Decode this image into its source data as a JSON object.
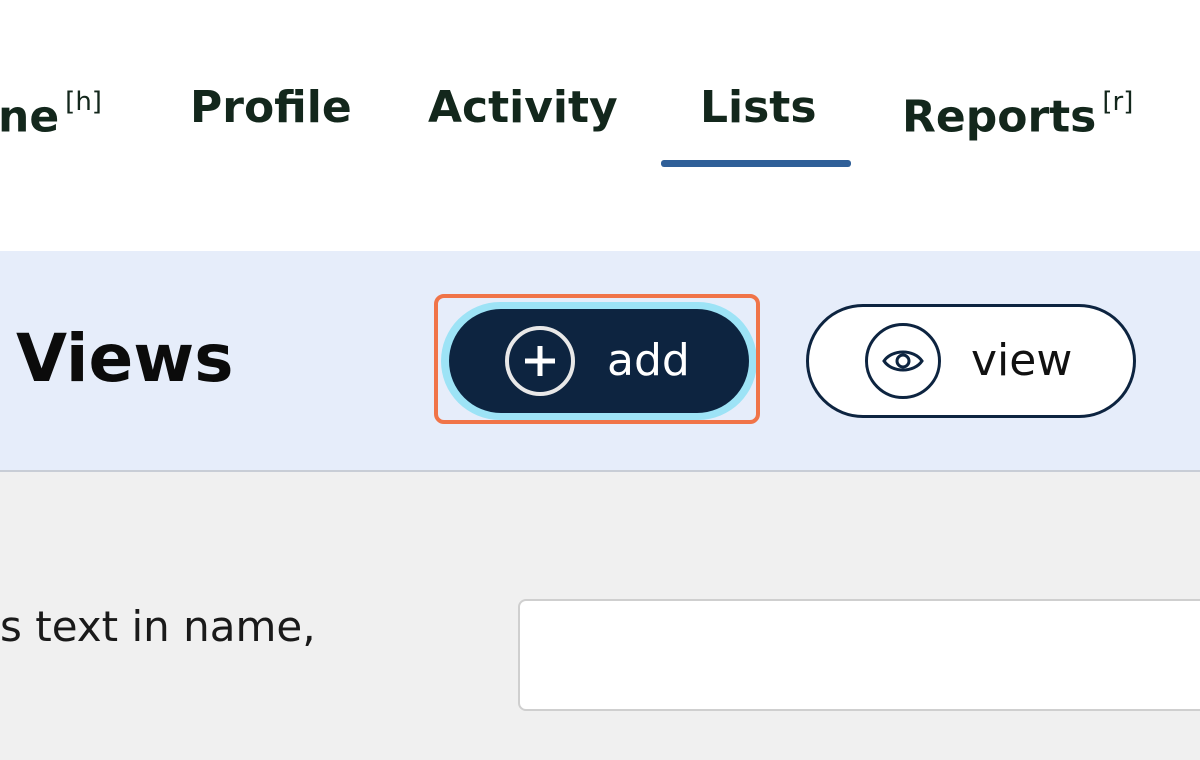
{
  "nav": {
    "tabs": [
      {
        "label": "ne",
        "accesskey": "[h]"
      },
      {
        "label": "Profile"
      },
      {
        "label": "Activity"
      },
      {
        "label": "Lists",
        "active": true
      },
      {
        "label": "Reports",
        "accesskey": "[r]"
      }
    ],
    "active_tab": "Lists",
    "underline_color": "#2f5f98"
  },
  "header": {
    "title": "Views",
    "add_button": {
      "label": "add",
      "icon": "plus-circle-icon",
      "highlighted": true
    },
    "view_button": {
      "label": "view",
      "icon": "eye-icon"
    }
  },
  "filter": {
    "label": "s text in name,",
    "value": ""
  },
  "colors": {
    "primary_dark": "#0d2440",
    "header_bg": "#e6edfa",
    "highlight_border": "#f07448"
  }
}
